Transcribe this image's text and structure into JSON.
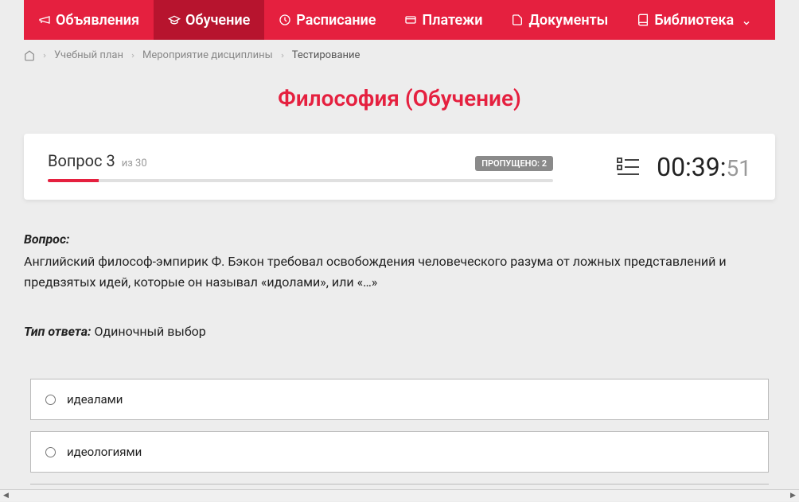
{
  "nav": {
    "items": [
      {
        "label": "Объявления"
      },
      {
        "label": "Обучение"
      },
      {
        "label": "Расписание"
      },
      {
        "label": "Платежи"
      },
      {
        "label": "Документы"
      },
      {
        "label": "Библиотека"
      }
    ]
  },
  "breadcrumb": {
    "items": [
      {
        "label": "Учебный план"
      },
      {
        "label": "Мероприятие дисциплины"
      }
    ],
    "current": "Тестирование"
  },
  "page_title": "Философия (Обучение)",
  "status": {
    "question_prefix": "Вопрос",
    "question_number": "3",
    "question_of": "из 30",
    "skipped_label": "ПРОПУЩЕНО: 2",
    "timer_main": "00:39:",
    "timer_sec": "51"
  },
  "question": {
    "heading": "Вопрос:",
    "text": "Английский философ-эмпирик Ф. Бэкон требовал освобождения человеческого разума от ложных представлений и предвзятых идей, которые он называл «идолами», или «…»",
    "answer_type_label": "Тип ответа:",
    "answer_type_value": " Одиночный выбор",
    "options": [
      {
        "label": "идеалами"
      },
      {
        "label": "идеологиями"
      }
    ]
  }
}
